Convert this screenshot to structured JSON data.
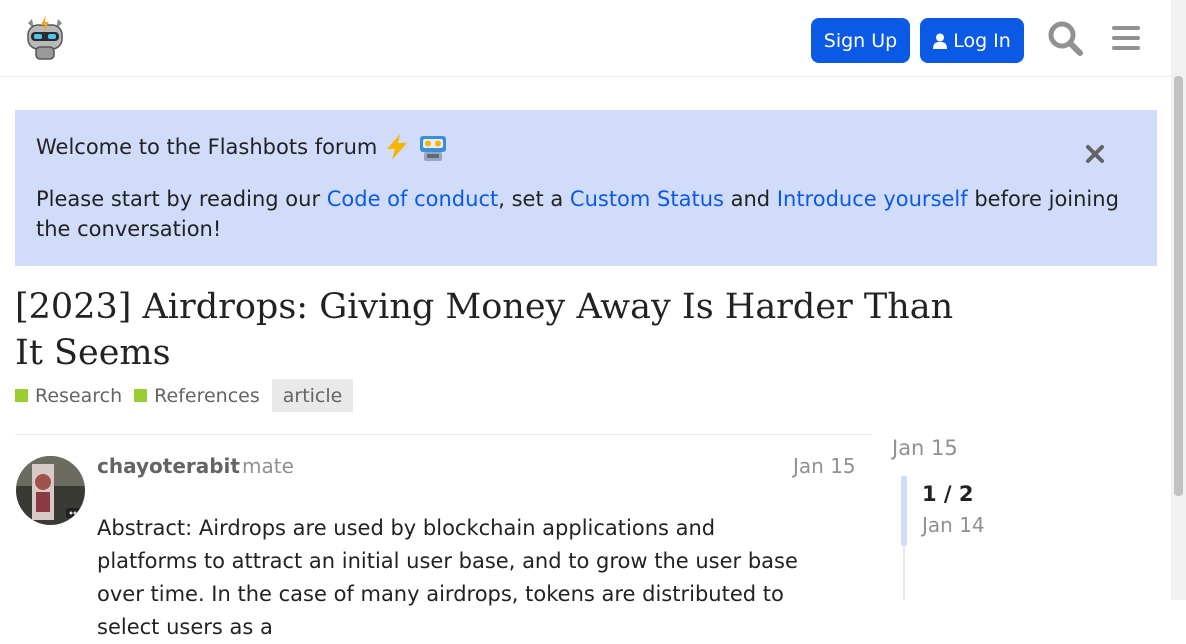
{
  "header": {
    "signup_label": "Sign Up",
    "login_label": "Log In",
    "logo_icon": "flashbots-robot-logo",
    "search_icon": "search-icon",
    "menu_icon": "hamburger-menu-icon"
  },
  "banner": {
    "title": "Welcome to the Flashbots forum",
    "text_prefix": "Please start by reading our ",
    "link_conduct": "Code of conduct",
    "text_mid1": ", set a ",
    "link_status": "Custom Status",
    "text_mid2": " and ",
    "link_introduce": "Introduce yourself",
    "text_suffix": " before joining the conversation!"
  },
  "topic": {
    "title": "[2023] Airdrops: Giving Money Away Is Harder Than It Seems",
    "categories": [
      "Research",
      "References"
    ],
    "category_color": "#9acd32",
    "tag": "article"
  },
  "post": {
    "username": "chayoterabit",
    "user_title": "mate",
    "date": "Jan 15",
    "body": "Abstract: Airdrops are used by blockchain applications and platforms to attract an initial user base, and to grow the user base over time. In the case of many airdrops, tokens are distributed to select users as a"
  },
  "timeline": {
    "start_date": "Jan 15",
    "position": "1 / 2",
    "current_date": "Jan 14"
  },
  "colors": {
    "accent": "#0a5ae6",
    "banner_bg": "#d1dcfb"
  }
}
